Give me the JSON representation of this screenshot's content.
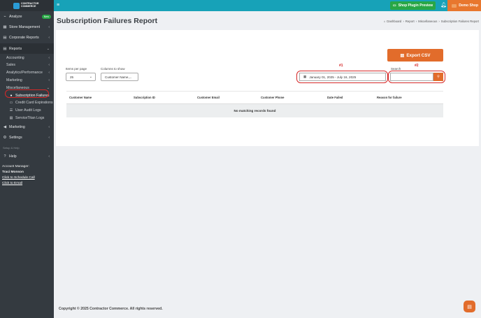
{
  "brand": {
    "logo_text": "CONTRACTOR COMMERCE"
  },
  "topbar": {
    "plugin_preview_label": "Shop Plugin Preview",
    "shop_name": "Demo Shop"
  },
  "sidebar": {
    "items": [
      {
        "label": "Analyze",
        "badge": "New"
      },
      {
        "label": "Store Management"
      },
      {
        "label": "Corporate Reports"
      },
      {
        "label": "Reports"
      }
    ],
    "reports_sub": [
      {
        "label": "Accounting"
      },
      {
        "label": "Sales"
      },
      {
        "label": "Analytics/Performance"
      },
      {
        "label": "Marketing"
      },
      {
        "label": "Miscellaneous"
      }
    ],
    "misc_sub": [
      {
        "label": "Subscription Failures"
      },
      {
        "label": "Credit Card Expirations"
      },
      {
        "label": "User Audit Logs"
      },
      {
        "label": "ServiceTitan Logs"
      }
    ],
    "bottom_items": [
      {
        "label": "Marketing"
      },
      {
        "label": "Settings"
      }
    ],
    "separator": "Setup & Help",
    "help_label": "Help",
    "account_manager_label": "Account Manager:",
    "account_manager_name": "Traci Monson",
    "schedule_link": "Click to Schedule Call",
    "email_link": "Click to Email"
  },
  "page": {
    "title": "Subscription Failures Report",
    "breadcrumb": [
      "Dashboard",
      "Report",
      "Miscellaneous",
      "Subscription Failures Report"
    ]
  },
  "controls": {
    "items_per_page_label": "Items per page",
    "items_per_page_value": "25",
    "columns_label": "Columns to show",
    "columns_value": "Customer Name,...",
    "date_range_value": "January 01, 2025 - July 16, 2025",
    "search_label": "Search",
    "export_label": "Export CSV"
  },
  "annotations": {
    "one": "#1",
    "two": "#2"
  },
  "table": {
    "columns": [
      "Customer Name",
      "Subscription ID",
      "Customer Email",
      "Customer Phone",
      "Date Failed",
      "Reason for failure"
    ],
    "empty_message": "No matching records found"
  },
  "footer": {
    "text": "Copyright © 2025 Contractor Commerce. All rights reserved."
  },
  "colors": {
    "accent": "#17a2b8",
    "orange": "#e26c2b",
    "sidebar": "#343a40",
    "annotation": "#d62828"
  }
}
